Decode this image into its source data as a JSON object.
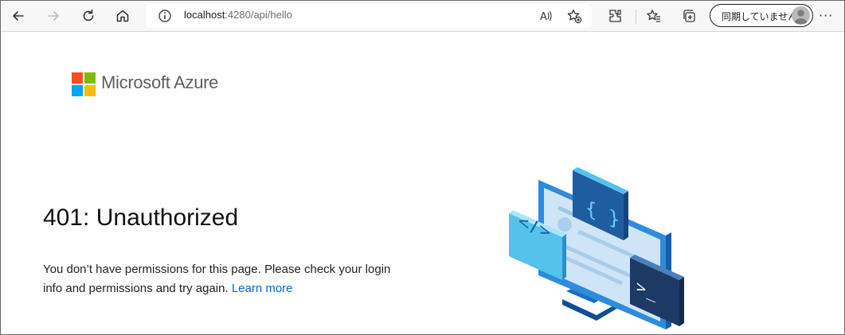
{
  "browser": {
    "url_host": "localhost",
    "url_path": ":4280/api/hello",
    "profile_label": "同期していません",
    "more_label": "···"
  },
  "page": {
    "brand": "Microsoft Azure",
    "title": "401: Unauthorized",
    "message": "You don’t have permissions for this page. Please check your login info and permissions and try again.",
    "link_label": "Learn more"
  },
  "colors": {
    "logo_red": "#f25022",
    "logo_green": "#7fba00",
    "logo_blue": "#00a4ef",
    "logo_yellow": "#ffb900",
    "link": "#0a66c8"
  },
  "icons": [
    "back-icon",
    "forward-icon",
    "refresh-icon",
    "home-icon",
    "info-icon",
    "read-aloud-icon",
    "add-favorite-icon",
    "extensions-icon",
    "favorites-icon",
    "collections-icon",
    "avatar",
    "more-icon"
  ]
}
